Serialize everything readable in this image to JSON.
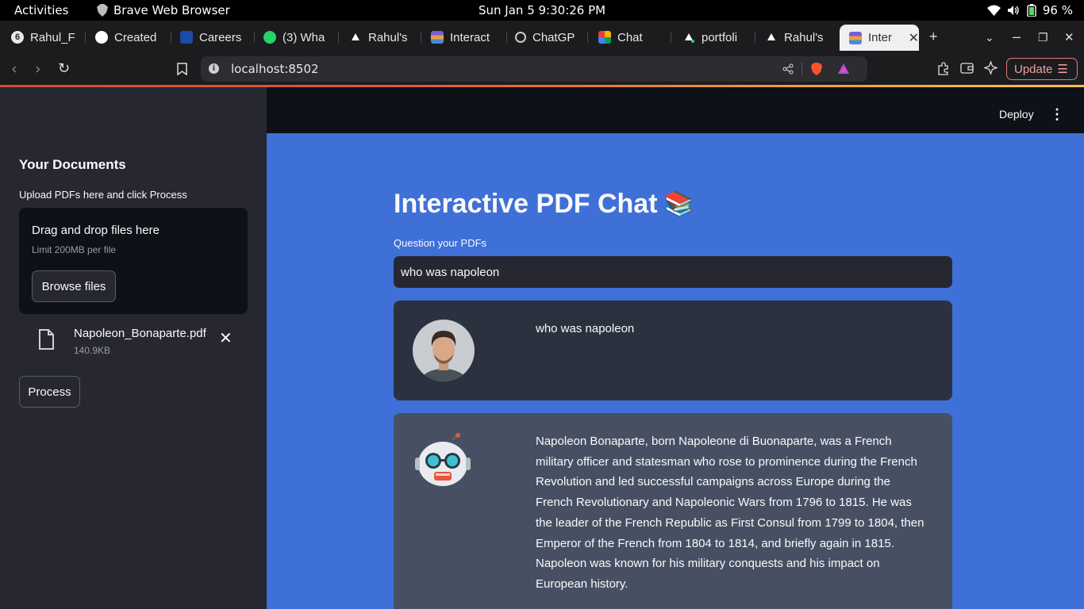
{
  "system_bar": {
    "activities": "Activities",
    "app_name": "Brave Web Browser",
    "datetime": "Sun Jan 5   9:30:26 PM",
    "battery": "96 %"
  },
  "tabs": [
    {
      "label": "Rahul_F",
      "icon": "app-icon",
      "color": "#3a3a3a"
    },
    {
      "label": "Created",
      "icon": "github-icon",
      "color": "#ffffff"
    },
    {
      "label": "Careers",
      "icon": "careers-icon",
      "color": "#1b4aa8"
    },
    {
      "label": "(3) Wha",
      "icon": "whatsapp-icon",
      "color": "#25d366"
    },
    {
      "label": "Rahul's",
      "icon": "vercel-icon",
      "color": "#ffffff"
    },
    {
      "label": "Interact",
      "icon": "books-icon",
      "color": "#7a5cd8"
    },
    {
      "label": "ChatGP",
      "icon": "chatgpt-icon",
      "color": "#cccccc"
    },
    {
      "label": "Chat",
      "icon": "chat-icon",
      "color": "#f4b400"
    },
    {
      "label": "portfoli",
      "icon": "vercel-icon",
      "color": "#ffffff"
    },
    {
      "label": "Rahul's",
      "icon": "vercel-icon",
      "color": "#ffffff"
    },
    {
      "label": "Inter",
      "icon": "books-icon",
      "color": "#7a5cd8"
    }
  ],
  "address_bar": {
    "url": "localhost:8502",
    "update_label": "Update"
  },
  "sidebar": {
    "title": "Your Documents",
    "upload_label": "Upload PDFs here and click Process",
    "dropzone_title": "Drag and drop files here",
    "dropzone_limit": "Limit 200MB per file",
    "browse_label": "Browse files",
    "file_name": "Napoleon_Bonaparte.pdf",
    "file_size": "140.9KB",
    "process_label": "Process"
  },
  "header": {
    "deploy_label": "Deploy"
  },
  "main": {
    "title": "Interactive PDF Chat",
    "title_emoji": "📚",
    "question_label": "Question your PDFs",
    "question_value": "who was napoleon",
    "messages": [
      {
        "role": "user",
        "text": "who was napoleon"
      },
      {
        "role": "bot",
        "text": "Napoleon Bonaparte, born Napoleone di Buonaparte, was a French military officer and statesman who rose to prominence during the French Revolution and led successful campaigns across Europe during the French Revolutionary and Napoleonic Wars from 1796 to 1815. He was the leader of the French Republic as First Consul from 1799 to 1804, then Emperor of the French from 1804 to 1814, and briefly again in 1815. Napoleon was known for his military conquests and his impact on European history."
      }
    ]
  },
  "colors": {
    "sidebar_bg": "#262730",
    "main_bg": "#3e70d8",
    "user_msg_bg": "#2b313e",
    "bot_msg_bg": "#475063"
  }
}
